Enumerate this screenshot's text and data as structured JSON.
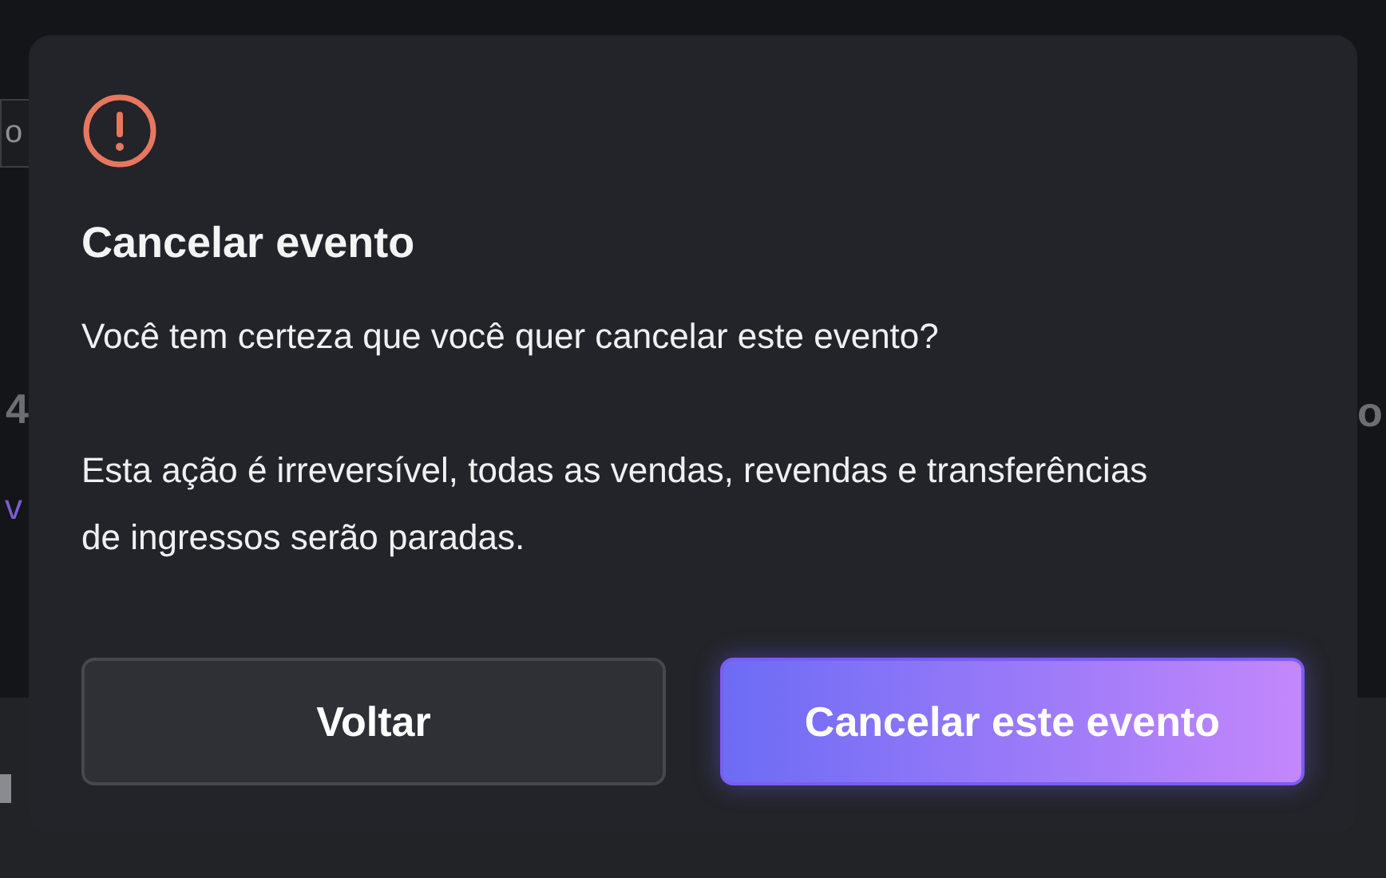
{
  "background": {
    "field_fragment": "o",
    "heading_fragment": "4",
    "link_fragment": "v",
    "right_fragment": "o"
  },
  "dialog": {
    "title": "Cancelar evento",
    "paragraphs": [
      "Você tem certeza que você quer cancelar este evento?",
      "Esta ação é irreversível, todas as vendas, revendas e transferências de ingressos serão paradas."
    ],
    "buttons": [
      {
        "label": "Voltar",
        "kind": "secondary"
      },
      {
        "label": "Cancelar este evento",
        "kind": "primary"
      }
    ]
  }
}
